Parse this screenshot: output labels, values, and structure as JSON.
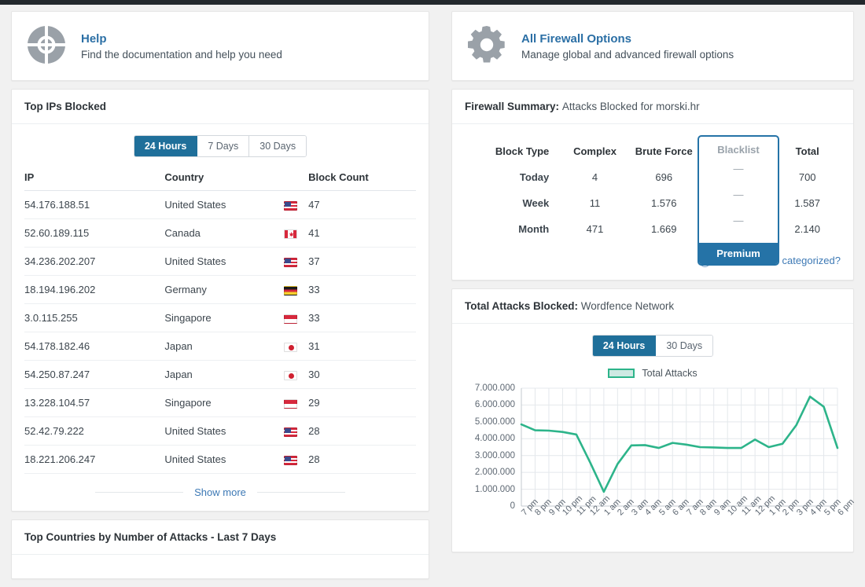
{
  "promos": [
    {
      "icon": "lifebuoy-icon",
      "title": "Help",
      "desc": "Find the documentation and help you need"
    },
    {
      "icon": "gear-icon",
      "title": "All Firewall Options",
      "desc": "Manage global and advanced firewall options"
    }
  ],
  "top_ips": {
    "title": "Top IPs Blocked",
    "tabs": [
      {
        "label": "24 Hours",
        "active": true
      },
      {
        "label": "7 Days",
        "active": false
      },
      {
        "label": "30 Days",
        "active": false
      }
    ],
    "columns": [
      "IP",
      "Country",
      "Block Count"
    ],
    "rows": [
      {
        "ip": "54.176.188.51",
        "country": "United States",
        "flag": "us",
        "count": "47"
      },
      {
        "ip": "52.60.189.115",
        "country": "Canada",
        "flag": "ca",
        "count": "41"
      },
      {
        "ip": "34.236.202.207",
        "country": "United States",
        "flag": "us",
        "count": "37"
      },
      {
        "ip": "18.194.196.202",
        "country": "Germany",
        "flag": "de",
        "count": "33"
      },
      {
        "ip": "3.0.115.255",
        "country": "Singapore",
        "flag": "sg",
        "count": "33"
      },
      {
        "ip": "54.178.182.46",
        "country": "Japan",
        "flag": "jp",
        "count": "31"
      },
      {
        "ip": "54.250.87.247",
        "country": "Japan",
        "flag": "jp",
        "count": "30"
      },
      {
        "ip": "13.228.104.57",
        "country": "Singapore",
        "flag": "sg",
        "count": "29"
      },
      {
        "ip": "52.42.79.222",
        "country": "United States",
        "flag": "us",
        "count": "28"
      },
      {
        "ip": "18.221.206.247",
        "country": "United States",
        "flag": "us",
        "count": "28"
      }
    ],
    "show_more": "Show more"
  },
  "top_countries": {
    "title": "Top Countries by Number of Attacks - Last 7 Days"
  },
  "firewall_summary": {
    "title_bold": "Firewall Summary:",
    "title_rest": "Attacks Blocked for morski.hr",
    "columns": [
      "Block Type",
      "Complex",
      "Brute Force",
      "Blacklist",
      "Total"
    ],
    "rows": [
      {
        "label": "Today",
        "complex": "4",
        "brute": "696",
        "blacklist": "—",
        "total": "700"
      },
      {
        "label": "Week",
        "complex": "11",
        "brute": "1.576",
        "blacklist": "—",
        "total": "1.587"
      },
      {
        "label": "Month",
        "complex": "471",
        "brute": "1.669",
        "blacklist": "—",
        "total": "2.140"
      }
    ],
    "premium_label": "Premium",
    "categorized_link": "How are these categorized?"
  },
  "attacks_chart": {
    "title_bold": "Total Attacks Blocked:",
    "title_rest": "Wordfence Network",
    "tabs": [
      {
        "label": "24 Hours",
        "active": true
      },
      {
        "label": "30 Days",
        "active": false
      }
    ]
  },
  "colors": {
    "accent_blue": "#1f6f9a",
    "link_blue": "#2b6fa5",
    "line_green": "#2db48a",
    "legend_fill": "#cfe9e3",
    "admin_bar": "#23282d"
  },
  "chart_data": {
    "type": "line",
    "title": "Total Attacks Blocked: Wordfence Network",
    "xlabel": "",
    "ylabel": "",
    "ylim": [
      0,
      7000000
    ],
    "yticks": [
      0,
      1000000,
      2000000,
      3000000,
      4000000,
      5000000,
      6000000,
      7000000
    ],
    "ytick_labels": [
      "0",
      "1.000.000",
      "2.000.000",
      "3.000.000",
      "4.000.000",
      "5.000.000",
      "6.000.000",
      "7.000.000"
    ],
    "grid": true,
    "legend": [
      "Total Attacks"
    ],
    "legend_position": "top-center",
    "x": [
      "7 pm",
      "8 pm",
      "9 pm",
      "10 pm",
      "11 pm",
      "12 am",
      "1 am",
      "2 am",
      "3 am",
      "4 am",
      "5 am",
      "6 am",
      "7 am",
      "8 am",
      "9 am",
      "10 am",
      "11 am",
      "12 pm",
      "1 pm",
      "2 pm",
      "3 pm",
      "4 pm",
      "5 pm",
      "6 pm"
    ],
    "series": [
      {
        "name": "Total Attacks",
        "values": [
          4850000,
          4500000,
          4480000,
          4400000,
          4250000,
          2600000,
          850000,
          2500000,
          3600000,
          3620000,
          3450000,
          3750000,
          3650000,
          3500000,
          3480000,
          3450000,
          3450000,
          3950000,
          3500000,
          3700000,
          4800000,
          6500000,
          5900000,
          3450000
        ]
      }
    ]
  }
}
